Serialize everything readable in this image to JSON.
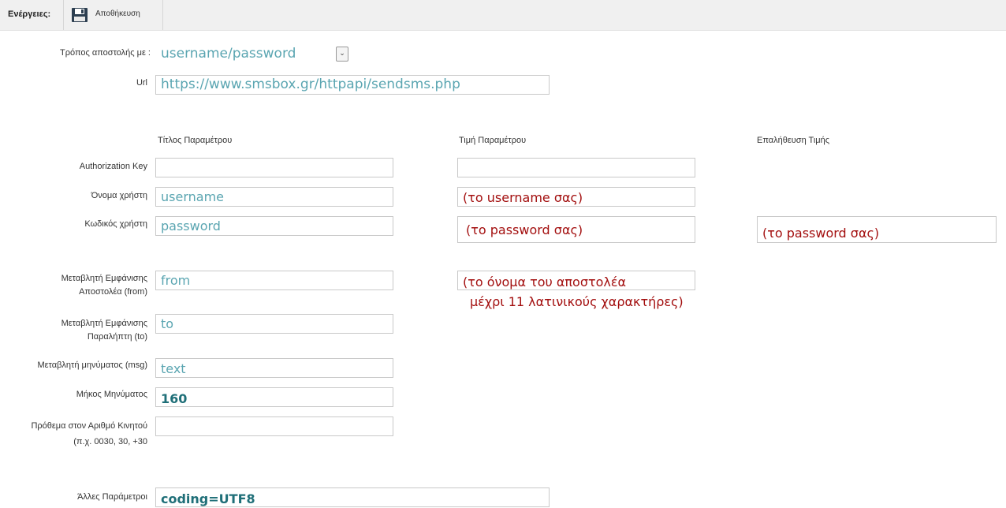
{
  "toolbar": {
    "actions_label": "Ενέργειες:",
    "save_label": "Αποθήκευση",
    "save_icon": "floppy-disk-icon"
  },
  "send_method": {
    "label": "Τρόπος αποστολής με :",
    "value": "username/password"
  },
  "url": {
    "label": "Url",
    "value": "https://www.smsbox.gr/httpapi/sendsms.php"
  },
  "columns": {
    "param_title": "Τίτλος Παραμέτρου",
    "param_value": "Τιμή Παραμέτρου",
    "value_verification": "Επαλήθευση Τιμής"
  },
  "rows": {
    "auth_key": {
      "label": "Authorization Key",
      "title": "",
      "value": ""
    },
    "username": {
      "label": "Όνομα χρήστη",
      "title": "username",
      "value": "(το username σας)"
    },
    "password": {
      "label": "Κωδικός χρήστη",
      "title": "password",
      "value": "(το password σας)",
      "verification": "(το password σας)"
    },
    "from": {
      "label_line1": "Μεταβλητή Εμφάνισης",
      "label_line2": "Αποστολέα (from)",
      "title": "from",
      "value": "(το όνομα του αποστολέα",
      "value_continued": "μέχρι 11 λατινικούς χαρακτήρες)"
    },
    "to": {
      "label_line1": "Μεταβλητή Εμφάνισης",
      "label_line2": "Παραλήπτη (to)",
      "title": "to"
    },
    "msg": {
      "label": "Μεταβλητή μηνύματος (msg)",
      "title": "text"
    },
    "length": {
      "label": "Μήκος Μηνύματος",
      "title": "160"
    },
    "prefix": {
      "label_line1": "Πρόθεμα στον Αριθμό Κινητού",
      "label_line2": "(π.χ. 0030, 30, +30",
      "title": ""
    },
    "other": {
      "label": "Άλλες Παράμετροι",
      "title": "coding=UTF8"
    }
  },
  "colors": {
    "teal_text": "#5aa5b1",
    "red_text": "#a30f0f",
    "toolbar_bg": "#f0f0f0"
  }
}
